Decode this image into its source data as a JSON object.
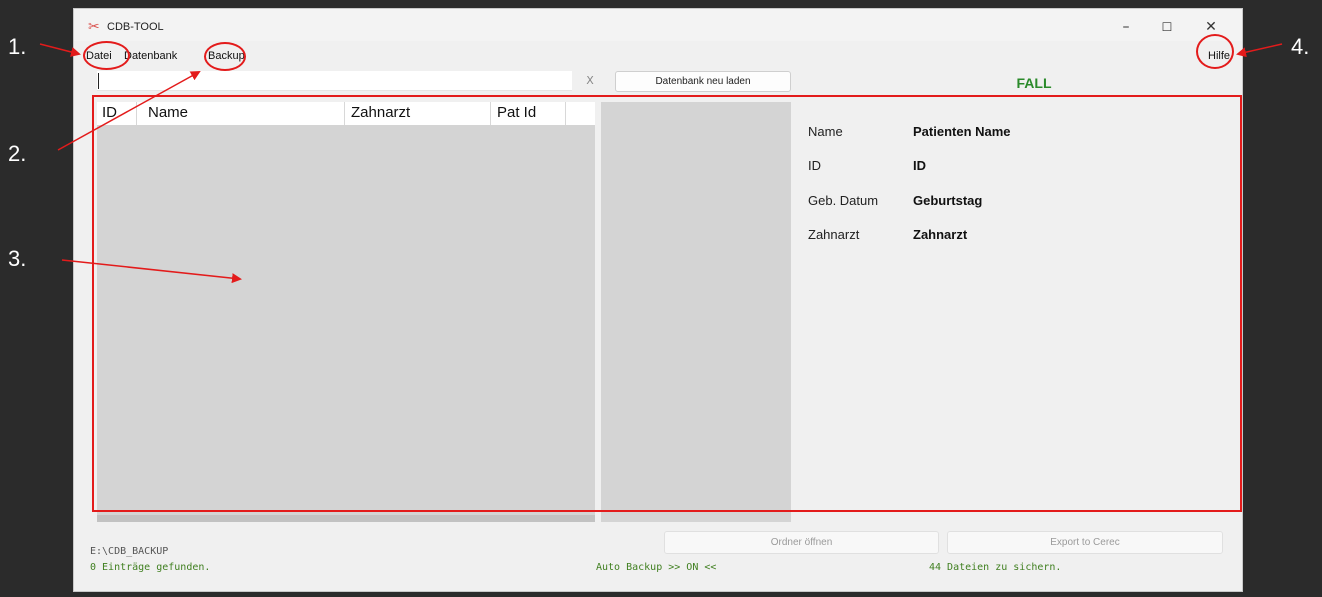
{
  "window": {
    "title": "CDB-TOOL",
    "controls": {
      "minimize": "–",
      "maximize": "☐",
      "close": "✕"
    }
  },
  "menu": {
    "items": [
      "Datei",
      "Datenbank",
      "Backup"
    ],
    "help": "Hilfe"
  },
  "toolbar": {
    "search_value": "",
    "clear_label": "X",
    "reload_label": "Datenbank neu laden",
    "fall_label": "FALL"
  },
  "table": {
    "columns": [
      "ID",
      "Name",
      "Zahnarzt",
      "Pat Id"
    ],
    "rows": []
  },
  "details": [
    {
      "label": "Name",
      "value": "Patienten Name"
    },
    {
      "label": "ID",
      "value": "ID"
    },
    {
      "label": "Geb. Datum",
      "value": "Geburtstag"
    },
    {
      "label": "Zahnarzt",
      "value": "Zahnarzt"
    }
  ],
  "actions": {
    "open_folder": "Ordner öffnen",
    "export": "Export to Cerec"
  },
  "status": {
    "path": "E:\\CDB_BACKUP",
    "entries": "0 Einträge gefunden.",
    "auto_backup": "Auto Backup >> ON <<",
    "files_to_backup": "44 Dateien zu sichern."
  },
  "annotations": {
    "callouts": [
      "1.",
      "2.",
      "3.",
      "4."
    ]
  },
  "colors": {
    "annotation": "#e31b1b",
    "fall": "#2a8a2a",
    "status_text": "#3f7f1f"
  }
}
